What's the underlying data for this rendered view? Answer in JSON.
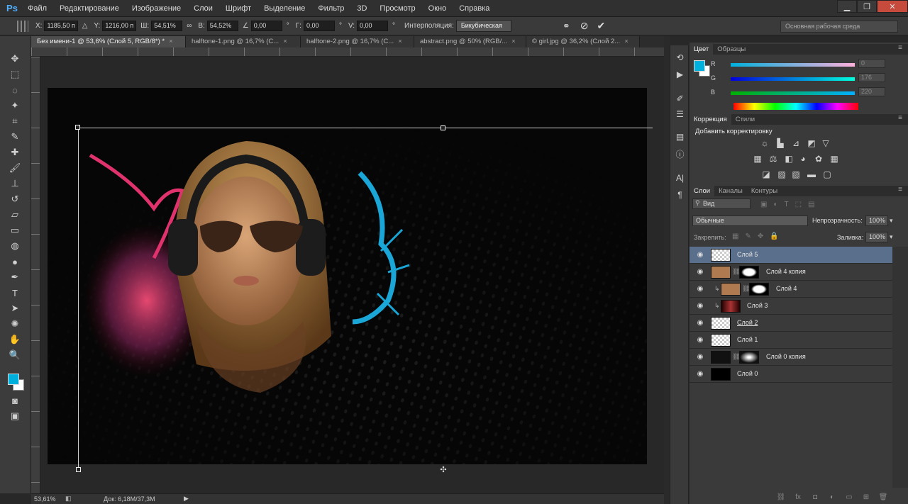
{
  "app": {
    "logo": "Ps"
  },
  "menu": [
    "Файл",
    "Редактирование",
    "Изображение",
    "Слои",
    "Шрифт",
    "Выделение",
    "Фильтр",
    "3D",
    "Просмотр",
    "Окно",
    "Справка"
  ],
  "window_controls": {
    "minimize": "▁",
    "restore": "❐",
    "close": "✕"
  },
  "options": {
    "x_label": "X:",
    "x_value": "1185,50 п",
    "y_label": "Y:",
    "y_value": "1216,00 п",
    "w_label": "Ш:",
    "w_value": "54,51%",
    "h_label": "В:",
    "h_value": "54,52%",
    "angle_value": "0,00",
    "deg": "°",
    "hskew_label": "Г:",
    "hskew_value": "0,00",
    "vskew_label": "V:",
    "vskew_value": "0,00",
    "interp_label": "Интерполяция:",
    "interp_value": "Бикубическая",
    "workspace": "Основная рабочая среда"
  },
  "tabs": [
    {
      "label": "Без имени-1 @ 53,6% (Слой 5, RGB/8*) *"
    },
    {
      "label": "halftone-1.png @ 16,7% (C..."
    },
    {
      "label": "halftone-2.png @ 16,7% (C..."
    },
    {
      "label": "abstract.png @ 50% (RGB/..."
    },
    {
      "label": "© girl.jpg @ 36,2% (Слой 2..."
    }
  ],
  "status": {
    "zoom": "53,61%",
    "doc": "Док: 6,18M/37,3M"
  },
  "color_panel": {
    "tabs": [
      "Цвет",
      "Образцы"
    ],
    "r_label": "R",
    "r_value": "0",
    "g_label": "G",
    "g_value": "176",
    "b_label": "B",
    "b_value": "220",
    "fg_color": "#00b0dc",
    "bg_color": "#ffffff"
  },
  "adjustments": {
    "tabs": [
      "Коррекция",
      "Стили"
    ],
    "title": "Добавить корректировку"
  },
  "layers_panel": {
    "tabs": [
      "Слои",
      "Каналы",
      "Контуры"
    ],
    "filter": "Вид",
    "blend_mode": "Обычные",
    "opacity_label": "Непрозрачность:",
    "opacity_value": "100%",
    "lock_label": "Закрепить:",
    "fill_label": "Заливка:",
    "fill_value": "100%",
    "layers": [
      {
        "name": "Слой 5",
        "selected": true
      },
      {
        "name": "Слой 4 копия"
      },
      {
        "name": "Слой 4"
      },
      {
        "name": "Слой 3"
      },
      {
        "name": "Слой 2"
      },
      {
        "name": "Слой 1"
      },
      {
        "name": "Слой 0 копия"
      },
      {
        "name": "Слой 0"
      }
    ]
  },
  "icons": {
    "eye": "eye-icon",
    "move": "move-tool-icon",
    "zoom": "zoom-tool-icon"
  }
}
